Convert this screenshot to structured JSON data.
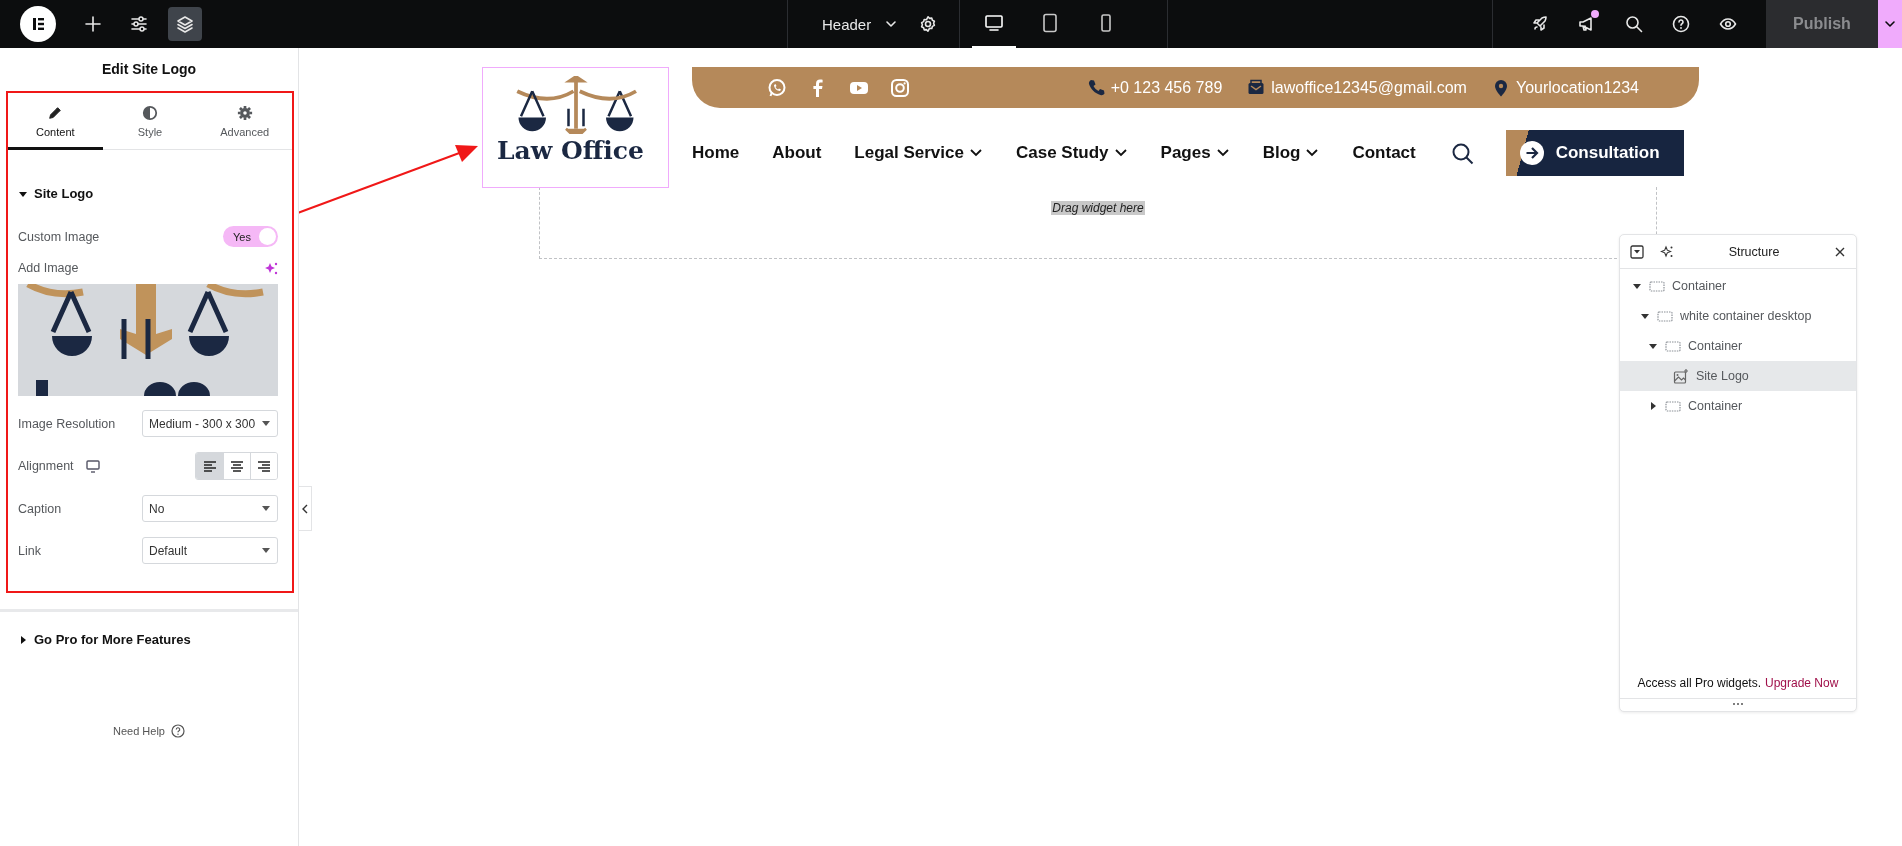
{
  "topbar": {
    "document": "Header",
    "devices": [
      {
        "kind": "desktop",
        "selected": true
      },
      {
        "kind": "tablet",
        "selected": false
      },
      {
        "kind": "mobile",
        "selected": false
      }
    ],
    "notification": true,
    "publish": "Publish"
  },
  "panel": {
    "title": "Edit Site Logo",
    "tabs": [
      {
        "kind": "content",
        "label": "Content",
        "selected": true
      },
      {
        "kind": "style",
        "label": "Style",
        "selected": false
      },
      {
        "kind": "advanced",
        "label": "Advanced",
        "selected": false
      }
    ],
    "section": {
      "title": "Site Logo",
      "expanded": true,
      "controls": [
        {
          "kind": "toggle",
          "label": "Custom Image",
          "value": "Yes",
          "on": true
        },
        {
          "kind": "image",
          "label": "Add Image"
        },
        {
          "kind": "select",
          "label": "Image Resolution",
          "value": "Medium - 300 x 300"
        },
        {
          "kind": "align",
          "label": "Alignment",
          "options": [
            {
              "kind": "left",
              "selected": true
            },
            {
              "kind": "center",
              "selected": false
            },
            {
              "kind": "right",
              "selected": false
            }
          ]
        },
        {
          "kind": "select",
          "label": "Caption",
          "value": "No"
        },
        {
          "kind": "select",
          "label": "Link",
          "value": "Default"
        }
      ]
    },
    "pro_section": {
      "title": "Go Pro for More Features",
      "expanded": false
    },
    "help": "Need Help"
  },
  "canvas": {
    "logo": {
      "text": "Law Office",
      "selected": true
    },
    "social": [
      {
        "kind": "whatsapp"
      },
      {
        "kind": "facebook"
      },
      {
        "kind": "youtube"
      },
      {
        "kind": "instagram"
      }
    ],
    "contacts": [
      {
        "kind": "phone",
        "text": "+0 123 456 789"
      },
      {
        "kind": "email",
        "text": "lawoffice12345@gmail.com"
      },
      {
        "kind": "location",
        "text": "Yourlocation1234"
      }
    ],
    "nav": [
      {
        "label": "Home",
        "dropdown": false
      },
      {
        "label": "About",
        "dropdown": false
      },
      {
        "label": "Legal Service",
        "dropdown": true
      },
      {
        "label": "Case Study",
        "dropdown": true
      },
      {
        "label": "Pages",
        "dropdown": true
      },
      {
        "label": "Blog",
        "dropdown": true
      },
      {
        "label": "Contact",
        "dropdown": false
      }
    ],
    "cta": "Consultation",
    "drop_hint": "Drag widget here"
  },
  "structure": {
    "title": "Structure",
    "tree": [
      {
        "kind": "container",
        "label": "Container",
        "expanded": true,
        "selected": false,
        "children": [
          {
            "kind": "container",
            "label": "white container desktop",
            "expanded": true,
            "selected": false,
            "children": [
              {
                "kind": "container",
                "label": "Container",
                "expanded": true,
                "selected": false,
                "children": [
                  {
                    "kind": "widget",
                    "label": "Site Logo",
                    "selected": true
                  }
                ]
              },
              {
                "kind": "container",
                "label": "Container",
                "expanded": false,
                "selected": false
              }
            ]
          }
        ]
      }
    ],
    "footer_text": "Access all Pro widgets.",
    "footer_link": "Upgrade Now"
  }
}
